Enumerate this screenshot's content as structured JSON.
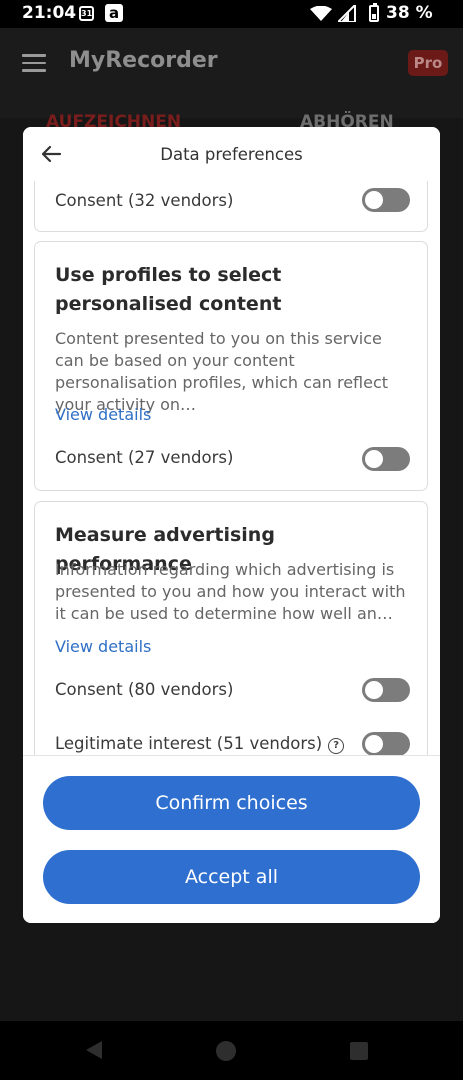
{
  "status_bar": {
    "time": "21:04",
    "calendar_day": "31",
    "notification_letter": "a",
    "battery": "38 %"
  },
  "app": {
    "title": "MyRecorder",
    "pro_badge": "Pro",
    "tab_record": "AUFZEICHNEN",
    "tab_listen": "ABHÖREN"
  },
  "dialog": {
    "title": "Data preferences",
    "top_card": {
      "consent_label": "Consent (32 vendors)",
      "consent_on": false
    },
    "cards": [
      {
        "title": "Use profiles to select personalised content",
        "description": "Content presented to you on this service can be based on your content personalisation profiles, which can reflect your activity on…",
        "link": "View details",
        "consent_label": "Consent (27 vendors)",
        "consent_on": false
      },
      {
        "title": "Measure advertising performance",
        "description": "Information regarding which advertising is presented to you and how you interact with it can be used to determine how well an…",
        "link": "View details",
        "consent_label": "Consent (80 vendors)",
        "consent_on": false,
        "legit_label": "Legitimate interest (51 vendors)",
        "legit_on": false
      }
    ],
    "confirm_button": "Confirm choices",
    "accept_button": "Accept all"
  },
  "icons": [
    "menu-icon",
    "back-arrow-icon",
    "help-icon",
    "wifi-icon",
    "signal-icon",
    "battery-icon"
  ]
}
